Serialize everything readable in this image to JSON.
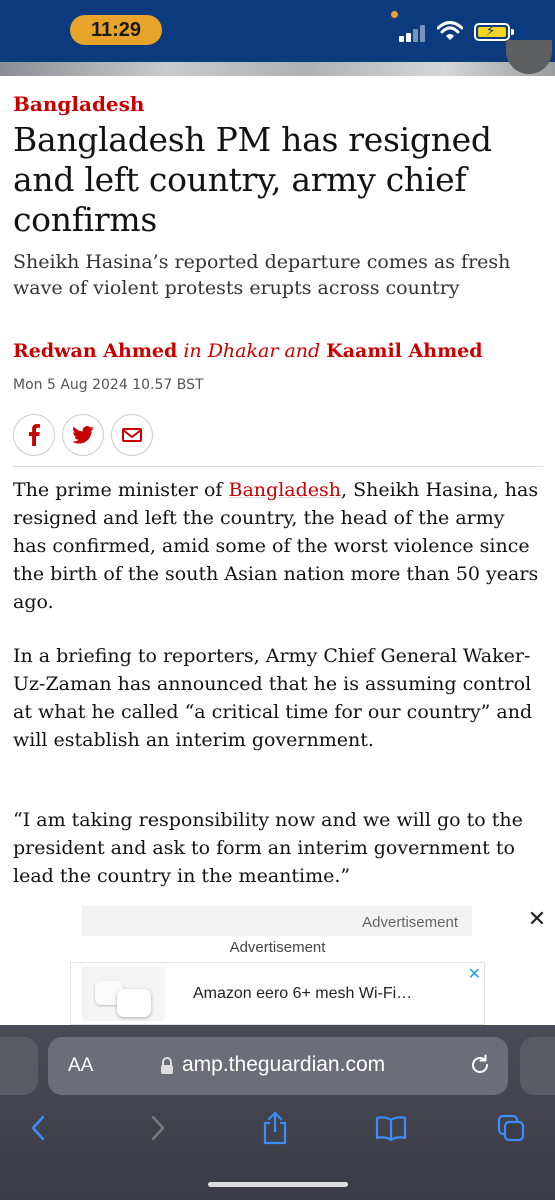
{
  "status_bar": {
    "time": "11:29"
  },
  "article": {
    "kicker": "Bangladesh",
    "headline": "Bangladesh PM has resigned and left country, army chief confirms",
    "standfirst": "Sheikh Hasina’s reported departure comes as fresh wave of violent protests erupts across country",
    "byline": {
      "author1": "Redwan Ahmed",
      "location": " in Dhakar and ",
      "author2": "Kaamil Ahmed"
    },
    "dateline": "Mon 5 Aug 2024 10.57 BST",
    "share_icons": [
      "facebook-icon",
      "twitter-icon",
      "email-icon"
    ],
    "paragraphs": {
      "p1_before": "The prime minister of ",
      "p1_link": "Bangladesh",
      "p1_after": ", Sheikh Hasina, has resigned and left the country, the head of the army has confirmed, amid some of the worst violence since the birth of the south Asian nation more than 50 years ago.",
      "p2": "In a briefing to reporters, Army Chief General Waker-Uz-Zaman has announced that he is assuming control at what he called “a critical time for our country” and will establish an interim government.",
      "p3": "“I am taking responsibility now and we will go to the president and ask to form an interim government to lead the country in the meantime.”"
    }
  },
  "ads": {
    "label_top": "Advertisement",
    "label": "Advertisement",
    "card_text": "Amazon eero 6+ mesh Wi-Fi…",
    "close_symbol": "✕"
  },
  "browser": {
    "aa_label": "AA",
    "url": "amp.theguardian.com",
    "toolbar_icons": [
      "back-icon",
      "forward-icon",
      "share-icon",
      "bookmarks-icon",
      "tabs-icon"
    ]
  },
  "colors": {
    "accent": "#c70000",
    "status_bar": "#0b3a7e",
    "time_pill": "#e8a32a"
  }
}
